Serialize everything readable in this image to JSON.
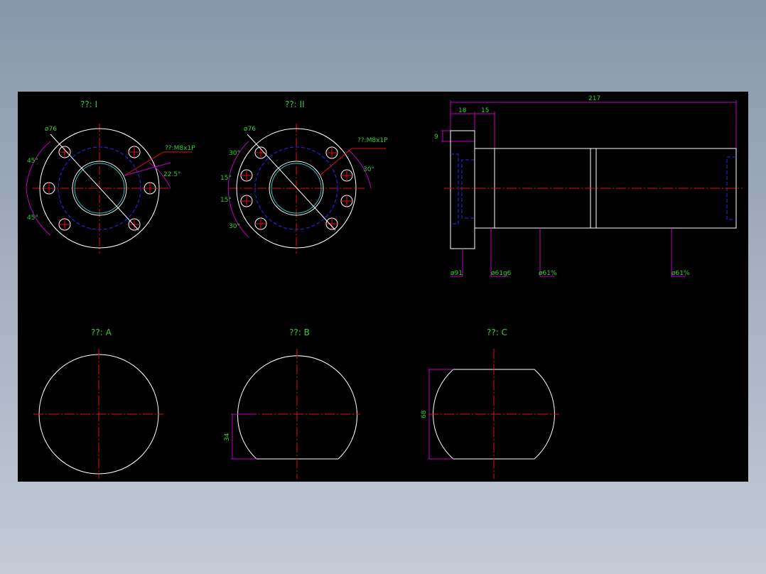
{
  "colors": {
    "background": "#000000",
    "outline": "#ffffff",
    "centerline": "#e01010",
    "hidden": "#2a2aff",
    "dimension": "#c000c0",
    "text": "#2fd02f"
  },
  "views": {
    "view1": {
      "title": "??: I",
      "dia": "ø76",
      "thread": "??:M8x1P",
      "angle_top": "45°",
      "angle_bottom": "45°",
      "angle_right": "22.5°"
    },
    "view2": {
      "title": "??: II",
      "dia": "ø76",
      "thread": "??:M8x1P",
      "a1": "30°",
      "a2": "15°",
      "a3": "15°",
      "a4": "30°",
      "a5": "30°"
    },
    "side": {
      "overall": "217",
      "d18": "18",
      "d15": "15",
      "d9": "9",
      "d91": "ø91",
      "d61g6": "ø61g6",
      "d61a": "ø61%",
      "d61b": "ø61%"
    },
    "viewA": {
      "title": "??: A"
    },
    "viewB": {
      "title": "??: B",
      "dim": "34"
    },
    "viewC": {
      "title": "??: C",
      "dim": "68"
    }
  }
}
